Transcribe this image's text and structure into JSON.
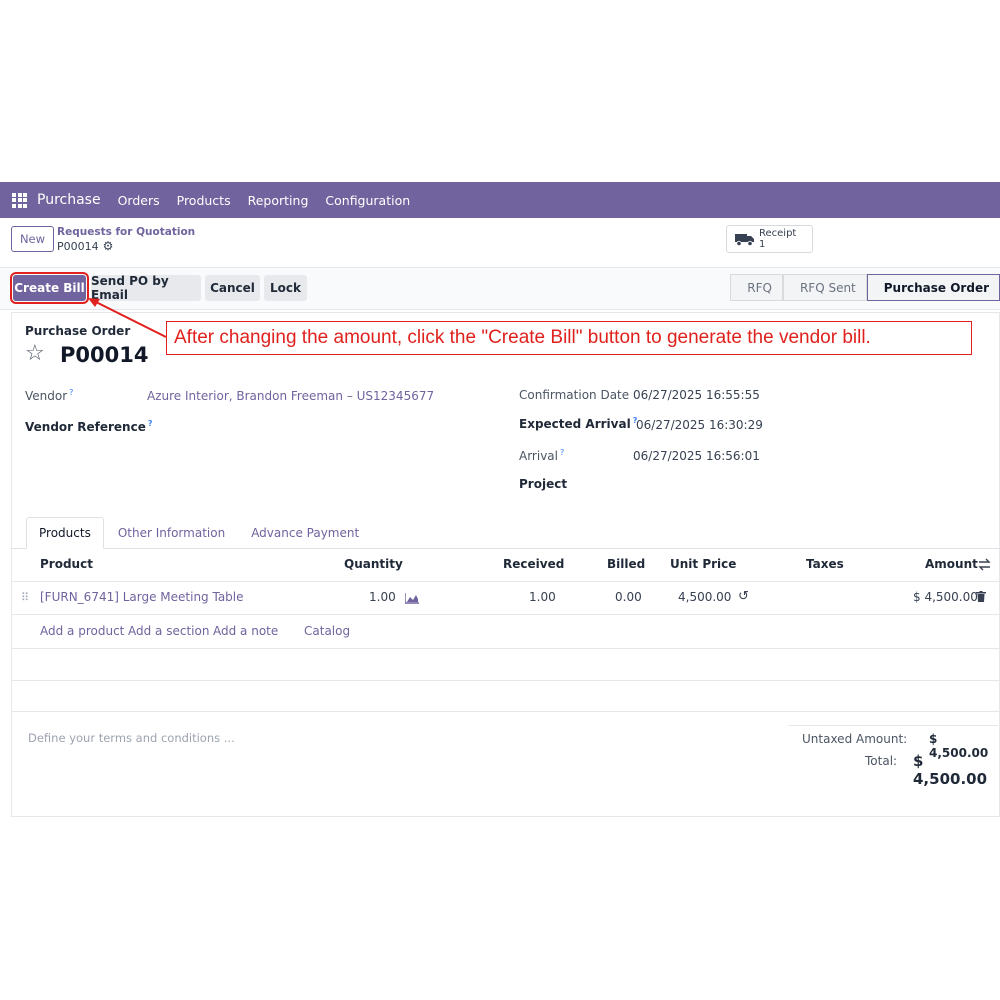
{
  "navbar": {
    "app_name": "Purchase",
    "menu": [
      "Orders",
      "Products",
      "Reporting",
      "Configuration"
    ]
  },
  "control_panel": {
    "new_label": "New",
    "breadcrumb_parent": "Requests for Quotation",
    "breadcrumb_current": "P00014",
    "receipt_label": "Receipt",
    "receipt_count": "1"
  },
  "actions": {
    "create_bill": "Create Bill",
    "send_po": "Send PO by Email",
    "cancel": "Cancel",
    "lock": "Lock"
  },
  "status_stages": [
    "RFQ",
    "RFQ Sent",
    "Purchase Order"
  ],
  "active_stage": "Purchase Order",
  "annotation": "After changing the amount, click the \"Create Bill\" button to generate the vendor bill.",
  "form": {
    "doc_type": "Purchase Order",
    "name": "P00014",
    "vendor_label": "Vendor",
    "vendor_value": "Azure Interior, Brandon Freeman – US12345677",
    "vendor_ref_label": "Vendor Reference",
    "confirmation_label": "Confirmation Date",
    "confirmation_value": "06/27/2025 16:55:55",
    "expected_label": "Expected Arrival",
    "expected_value": "06/27/2025 16:30:29",
    "arrival_label": "Arrival",
    "arrival_value": "06/27/2025 16:56:01",
    "project_label": "Project",
    "help_mark": "?"
  },
  "tabs": [
    "Products",
    "Other Information",
    "Advance Payment"
  ],
  "table": {
    "headers": {
      "product": "Product",
      "quantity": "Quantity",
      "received": "Received",
      "billed": "Billed",
      "unit_price": "Unit Price",
      "taxes": "Taxes",
      "amount": "Amount"
    },
    "rows": [
      {
        "product": "[FURN_6741] Large Meeting Table",
        "quantity": "1.00",
        "received": "1.00",
        "billed": "0.00",
        "unit_price": "4,500.00",
        "taxes": "",
        "amount": "$ 4,500.00"
      }
    ],
    "add_links": [
      "Add a product",
      "Add a section",
      "Add a note",
      "Catalog"
    ]
  },
  "terms_placeholder": "Define your terms and conditions ...",
  "totals": {
    "untaxed_label": "Untaxed Amount:",
    "untaxed_value": "$ 4,500.00",
    "total_label": "Total:",
    "total_value": "$ 4,500.00"
  },
  "colors": {
    "brand": "#71639e",
    "annotation": "#e0211d"
  }
}
